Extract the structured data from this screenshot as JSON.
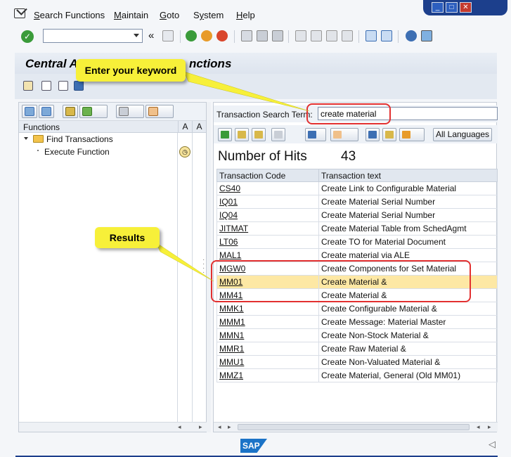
{
  "menu": {
    "items": [
      {
        "label": "Search Functions",
        "ul": "S"
      },
      {
        "label": "Maintain",
        "ul": "M"
      },
      {
        "label": "Goto",
        "ul": "G"
      },
      {
        "label": "System",
        "ul": "y"
      },
      {
        "label": "Help",
        "ul": "H"
      }
    ]
  },
  "window_controls": {
    "minimize": "_",
    "maximize": "□",
    "close": "✕"
  },
  "toolbar": {
    "back_glyph": "«"
  },
  "title": {
    "left": "Central A",
    "right": "nctions"
  },
  "left_panel": {
    "header_label": "Functions",
    "col_a1": "A",
    "col_a2": "A",
    "tree": [
      {
        "label": "Find Transactions"
      },
      {
        "label": "Execute Function"
      }
    ]
  },
  "search": {
    "label": "Transaction Search Term:",
    "value": "create material"
  },
  "right_toolbar": {
    "languages_button": "All Languages"
  },
  "hits": {
    "label": "Number of Hits",
    "count": "43"
  },
  "results": {
    "columns": [
      "Transaction Code",
      "Transaction text"
    ],
    "rows": [
      {
        "code": "CS40",
        "text": "Create Link to Configurable Material"
      },
      {
        "code": "IQ01",
        "text": "Create Material Serial Number"
      },
      {
        "code": "IQ04",
        "text": "Create Material Serial Number"
      },
      {
        "code": "JITMAT",
        "text": "Create Material Table from SchedAgmt"
      },
      {
        "code": "LT06",
        "text": "Create TO for Material Document"
      },
      {
        "code": "MAL1",
        "text": "Create material via ALE"
      },
      {
        "code": "MGW0",
        "text": "Create Components for Set Material"
      },
      {
        "code": "MM01",
        "text": "Create Material &"
      },
      {
        "code": "MM41",
        "text": "Create Material &"
      },
      {
        "code": "MMK1",
        "text": "Create Configurable Material &"
      },
      {
        "code": "MMM1",
        "text": "Create Message: Material Master"
      },
      {
        "code": "MMN1",
        "text": "Create Non-Stock Material &"
      },
      {
        "code": "MMR1",
        "text": "Create Raw Material &"
      },
      {
        "code": "MMU1",
        "text": "Create Non-Valuated Material &"
      },
      {
        "code": "MMZ1",
        "text": "Create Material, General (Old MM01)"
      }
    ],
    "selected_index": 7
  },
  "callouts": {
    "keyword": "Enter your keyword",
    "results": "Results"
  },
  "footer": {
    "logo": "SAP"
  },
  "colors": {
    "accent_blue": "#1c3f8c",
    "callout_yellow": "#f7f039",
    "highlight_red": "#e23030",
    "selected_row": "#fde8a4"
  }
}
